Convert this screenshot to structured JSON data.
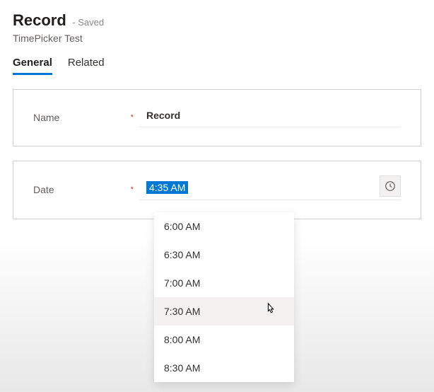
{
  "header": {
    "title": "Record",
    "status": "- Saved",
    "subtitle": "TimePicker Test"
  },
  "tabs": {
    "items": [
      {
        "label": "General",
        "active": true
      },
      {
        "label": "Related",
        "active": false
      }
    ]
  },
  "fields": {
    "name": {
      "label": "Name",
      "required_marker": "*",
      "value": "Record"
    },
    "date": {
      "label": "Date",
      "required_marker": "*",
      "value": "4:35 AM"
    }
  },
  "icons": {
    "clock": "clock-icon"
  },
  "time_dropdown": {
    "options": [
      {
        "label": "6:00 AM",
        "hover": false
      },
      {
        "label": "6:30 AM",
        "hover": false
      },
      {
        "label": "7:00 AM",
        "hover": false
      },
      {
        "label": "7:30 AM",
        "hover": true
      },
      {
        "label": "8:00 AM",
        "hover": false
      },
      {
        "label": "8:30 AM",
        "hover": false
      }
    ]
  }
}
